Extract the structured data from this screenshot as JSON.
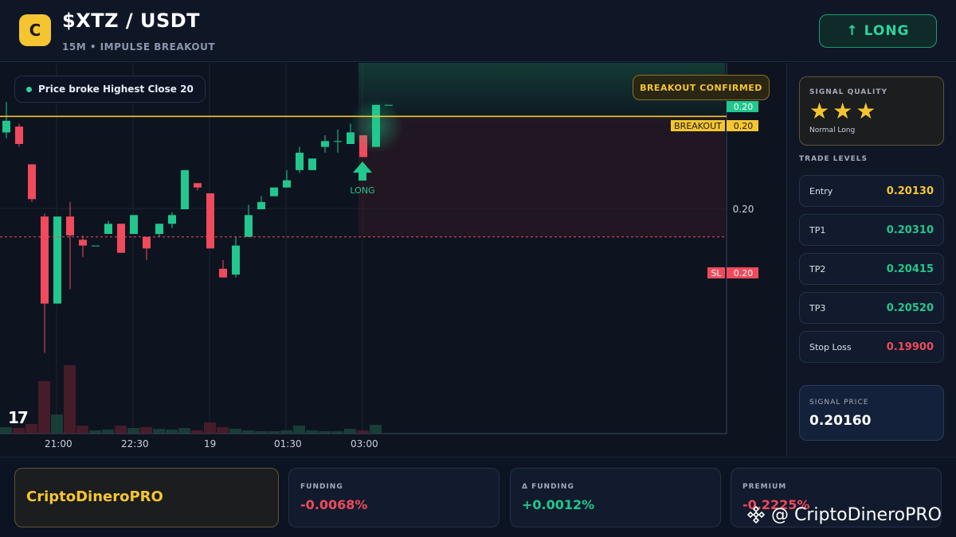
{
  "header": {
    "logo_letter": "C",
    "title": "$XTZ / USDT",
    "subtitle": "15M • IMPULSE BREAKOUT",
    "signal_button": "↑ LONG"
  },
  "chart": {
    "note": "Price broke Highest Close 20",
    "badge": "BREAKOUT CONFIRMED",
    "long_marker": "LONG",
    "watermark_logo": "17",
    "price_tags": {
      "current": "0.20",
      "breakout_label": "BREAKOUT",
      "breakout_value": "0.20",
      "mid_axis": "0.20",
      "sl_label": "SL",
      "sl_value": "0.20"
    },
    "x_ticks": [
      "21:00",
      "22:30",
      "19",
      "01:30",
      "03:00"
    ],
    "colors": {
      "up": "#22c78d",
      "down": "#f04a5c",
      "breakout_line": "#f5c531",
      "sl_line": "#f04a5c"
    }
  },
  "chart_data": {
    "type": "candlestick",
    "title": "",
    "xlabel": "",
    "ylabel": "",
    "candles": [
      {
        "o": 0.20174,
        "c": 0.20182,
        "h": 0.20195,
        "l": 0.2017,
        "v": 40
      },
      {
        "o": 0.20178,
        "c": 0.20166,
        "h": 0.2018,
        "l": 0.20164,
        "v": 35
      },
      {
        "o": 0.20152,
        "c": 0.20128,
        "h": 0.20152,
        "l": 0.20126,
        "v": 60
      },
      {
        "o": 0.20116,
        "c": 0.20056,
        "h": 0.20118,
        "l": 0.20022,
        "v": 330
      },
      {
        "o": 0.20056,
        "c": 0.20116,
        "h": 0.20116,
        "l": 0.20056,
        "v": 120
      },
      {
        "o": 0.20116,
        "c": 0.20103,
        "h": 0.20126,
        "l": 0.20066,
        "v": 430
      },
      {
        "o": 0.201,
        "c": 0.20096,
        "h": 0.20103,
        "l": 0.20088,
        "v": 50
      },
      {
        "o": 0.20096,
        "c": 0.20096,
        "h": 0.20096,
        "l": 0.20096,
        "v": 20
      },
      {
        "o": 0.20104,
        "c": 0.20111,
        "h": 0.20113,
        "l": 0.20104,
        "v": 25
      },
      {
        "o": 0.20111,
        "c": 0.20091,
        "h": 0.20111,
        "l": 0.20091,
        "v": 50
      },
      {
        "o": 0.20104,
        "c": 0.20117,
        "h": 0.20117,
        "l": 0.20104,
        "v": 35
      },
      {
        "o": 0.20102,
        "c": 0.20094,
        "h": 0.20102,
        "l": 0.20086,
        "v": 40
      },
      {
        "o": 0.20104,
        "c": 0.20111,
        "h": 0.20111,
        "l": 0.20102,
        "v": 30
      },
      {
        "o": 0.20111,
        "c": 0.20117,
        "h": 0.20119,
        "l": 0.20108,
        "v": 25
      },
      {
        "o": 0.20121,
        "c": 0.20148,
        "h": 0.20148,
        "l": 0.20121,
        "v": 35
      },
      {
        "o": 0.20139,
        "c": 0.20136,
        "h": 0.20139,
        "l": 0.20134,
        "v": 20
      },
      {
        "o": 0.20132,
        "c": 0.20094,
        "h": 0.20132,
        "l": 0.20094,
        "v": 70
      },
      {
        "o": 0.2008,
        "c": 0.20074,
        "h": 0.20086,
        "l": 0.20074,
        "v": 40
      },
      {
        "o": 0.20076,
        "c": 0.20096,
        "h": 0.20102,
        "l": 0.20074,
        "v": 30
      },
      {
        "o": 0.20102,
        "c": 0.20117,
        "h": 0.20124,
        "l": 0.20102,
        "v": 20
      },
      {
        "o": 0.20121,
        "c": 0.20126,
        "h": 0.2013,
        "l": 0.20121,
        "v": 15
      },
      {
        "o": 0.2013,
        "c": 0.20136,
        "h": 0.20136,
        "l": 0.2013,
        "v": 15
      },
      {
        "o": 0.20136,
        "c": 0.20141,
        "h": 0.20148,
        "l": 0.20136,
        "v": 20
      },
      {
        "o": 0.20148,
        "c": 0.2016,
        "h": 0.20164,
        "l": 0.20146,
        "v": 50
      },
      {
        "o": 0.20148,
        "c": 0.20156,
        "h": 0.20156,
        "l": 0.20148,
        "v": 20
      },
      {
        "o": 0.20164,
        "c": 0.20168,
        "h": 0.20172,
        "l": 0.2016,
        "v": 15
      },
      {
        "o": 0.20168,
        "c": 0.20168,
        "h": 0.20176,
        "l": 0.2016,
        "v": 15
      },
      {
        "o": 0.20166,
        "c": 0.20174,
        "h": 0.2018,
        "l": 0.20166,
        "v": 30
      },
      {
        "o": 0.20172,
        "c": 0.20157,
        "h": 0.20172,
        "l": 0.20157,
        "v": 20
      },
      {
        "o": 0.20164,
        "c": 0.20193,
        "h": 0.20193,
        "l": 0.20164,
        "v": 55
      },
      {
        "o": 0.20193,
        "c": 0.20193,
        "h": 0.20193,
        "l": 0.20193,
        "v": 0
      }
    ],
    "levels": {
      "breakout": 0.20185,
      "stop_loss": 0.20102
    },
    "ylim": [
      0.2003,
      0.202
    ]
  },
  "panel": {
    "quality_label": "SIGNAL QUALITY",
    "stars": "★★★",
    "quality_sub": "Normal Long",
    "levels_title": "TRADE LEVELS",
    "levels": [
      {
        "name": "Entry",
        "value": "0.20130",
        "color": "#f5c531"
      },
      {
        "name": "TP1",
        "value": "0.20310",
        "color": "#22c78d"
      },
      {
        "name": "TP2",
        "value": "0.20415",
        "color": "#22c78d"
      },
      {
        "name": "TP3",
        "value": "0.20520",
        "color": "#22c78d"
      },
      {
        "name": "Stop Loss",
        "value": "0.19900",
        "color": "#f04a5c"
      }
    ],
    "signal_price_label": "SIGNAL PRICE",
    "signal_price": "0.20160"
  },
  "footer": {
    "brand": "CriptoDineroPRO",
    "cards": [
      {
        "label": "FUNDING",
        "value": "-0.0068%",
        "color": "#f04a5c"
      },
      {
        "label": "Δ FUNDING",
        "value": "+0.0012%",
        "color": "#22c78d"
      },
      {
        "label": "PREMIUM",
        "value": "-0.2225%",
        "color": "#f04a5c"
      }
    ],
    "watermark": "@ CriptoDineroPRO"
  }
}
